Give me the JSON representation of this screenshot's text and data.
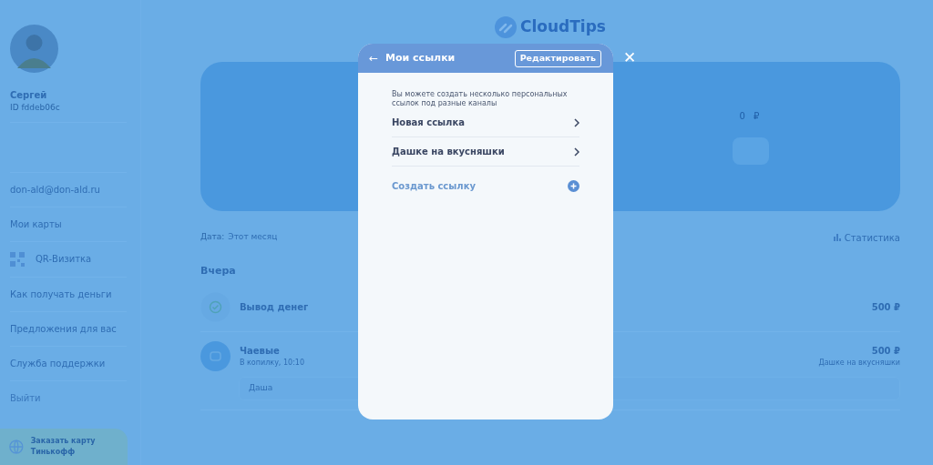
{
  "sidebar": {
    "user": {
      "name": "Сергей",
      "id": "ID fddeb06c"
    },
    "items": [
      {
        "kind": "text",
        "label": "don-ald@don-ald.ru"
      },
      {
        "kind": "text",
        "label": "Мои карты"
      },
      {
        "kind": "qr",
        "label": "QR-Визитка"
      },
      {
        "kind": "text",
        "label": "Как получать деньги"
      },
      {
        "kind": "text",
        "label": "Предложения для вас"
      },
      {
        "kind": "text",
        "label": "Служба поддержки"
      },
      {
        "kind": "muted",
        "label": "Выйти"
      }
    ],
    "promo": {
      "title": "Заказать карту Тинькофф"
    }
  },
  "logo": "CloudTips",
  "balance_card": {
    "amount": "0 ₽"
  },
  "filter": {
    "label": "Дата:",
    "value": "Этот месяц",
    "stats": "Статистика"
  },
  "history": {
    "day": "Вчера",
    "rows": [
      {
        "kind": "withdraw",
        "title": "Вывод денег",
        "amount": "500 ₽"
      },
      {
        "kind": "tip",
        "title": "Чаевые",
        "subtitle": "В копилку, 10:10",
        "amount": "500 ₽",
        "link": "Дашке на вкусняшки",
        "comment": "Даша"
      }
    ]
  },
  "modal": {
    "title": "Мои ссылки",
    "back": "←",
    "edit": "Редактировать",
    "close": "✕",
    "hint": "Вы можете создать несколько персональных ссылок под разные каналы",
    "links": [
      {
        "label": "Новая ссылка"
      },
      {
        "label": "Дашке на вкусняшки"
      }
    ],
    "create": "Создать ссылку"
  }
}
